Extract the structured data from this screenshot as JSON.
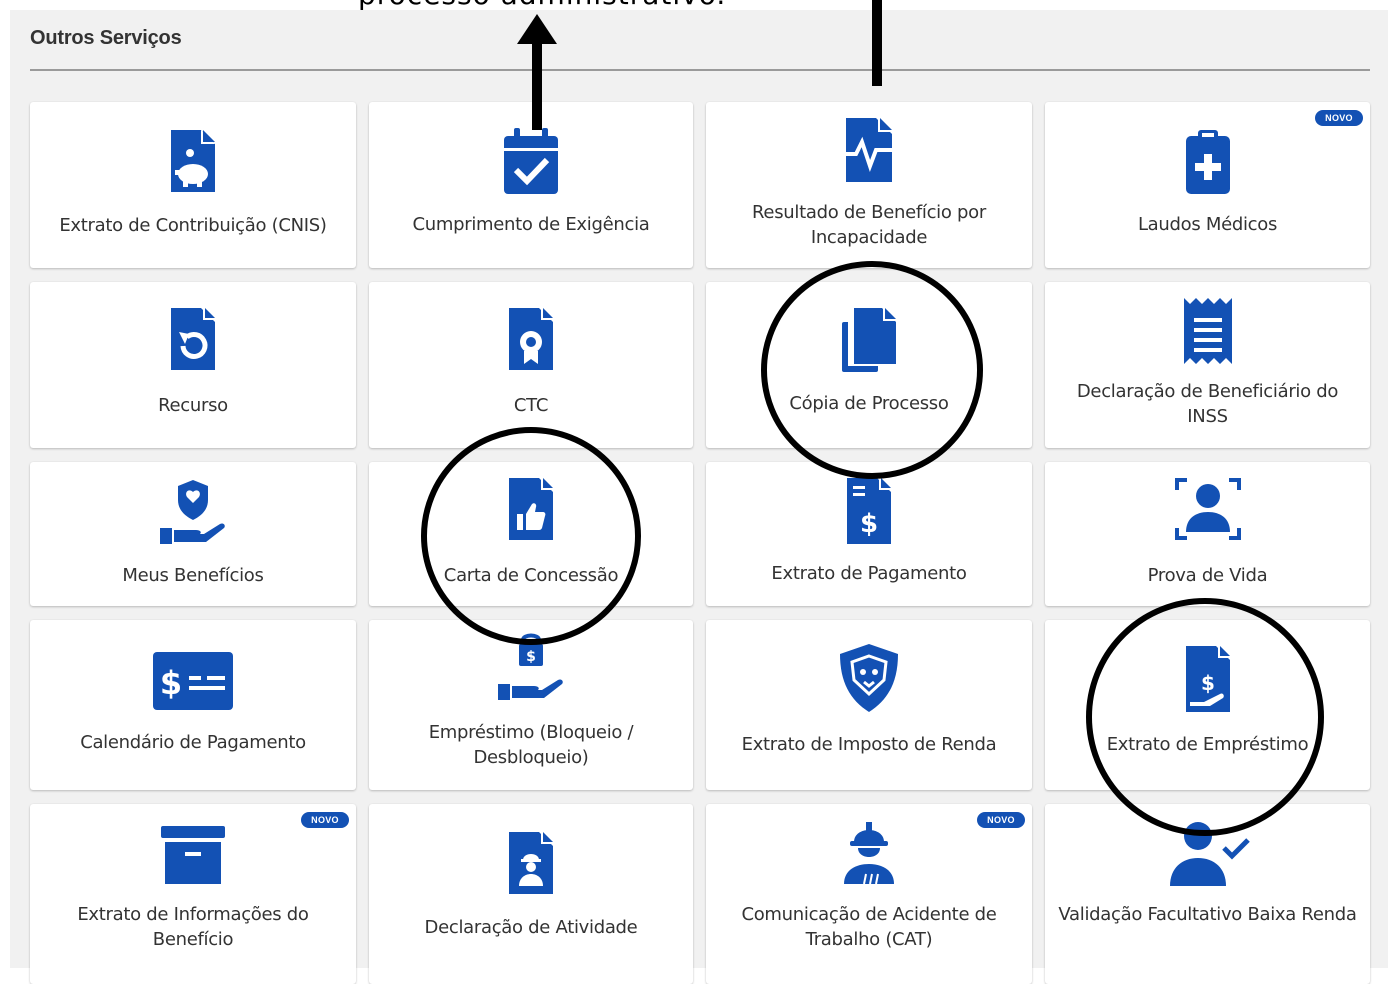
{
  "annotation": {
    "top_text": "processo administrativo."
  },
  "section": {
    "title": "Outros Serviços"
  },
  "badge_label": "NOVO",
  "colors": {
    "icon": "#1351b4",
    "panel": "#f1f1f1",
    "card": "#ffffff",
    "text": "#333333"
  },
  "services": [
    {
      "label": "Extrato de Contribuição (CNIS)",
      "icon": "piggy-bank-document-icon"
    },
    {
      "label": "Cumprimento de Exigência",
      "icon": "calendar-check-icon"
    },
    {
      "label": "Resultado de Benefício por Incapacidade",
      "icon": "document-pulse-icon"
    },
    {
      "label": "Laudos Médicos",
      "icon": "medical-clipboard-icon",
      "badge": "NOVO"
    },
    {
      "label": "Recurso",
      "icon": "document-undo-icon"
    },
    {
      "label": "CTC",
      "icon": "document-certificate-icon"
    },
    {
      "label": "Cópia de Processo",
      "icon": "copy-documents-icon"
    },
    {
      "label": "Declaração de Beneficiário do INSS",
      "icon": "receipt-icon"
    },
    {
      "label": "Meus Benefícios",
      "icon": "hand-shield-icon"
    },
    {
      "label": "Carta de Concessão",
      "icon": "document-thumbs-up-icon"
    },
    {
      "label": "Extrato de Pagamento",
      "icon": "document-dollar-icon"
    },
    {
      "label": "Prova de Vida",
      "icon": "face-scan-icon"
    },
    {
      "label": "Calendário de Pagamento",
      "icon": "money-card-icon"
    },
    {
      "label": "Empréstimo (Bloqueio / Desbloqueio)",
      "icon": "hand-lock-icon"
    },
    {
      "label": "Extrato de Imposto de Renda",
      "icon": "lion-shield-icon"
    },
    {
      "label": "Extrato de Empréstimo",
      "icon": "document-hand-dollar-icon"
    },
    {
      "label": "Extrato de Informações do Benefício",
      "icon": "archive-box-icon",
      "badge": "NOVO"
    },
    {
      "label": "Declaração de Atividade",
      "icon": "document-worker-icon"
    },
    {
      "label": "Comunicação de Acidente de Trabalho (CAT)",
      "icon": "construction-worker-icon",
      "badge": "NOVO"
    },
    {
      "label": "Validação Facultativo Baixa Renda",
      "icon": "user-check-icon"
    }
  ]
}
